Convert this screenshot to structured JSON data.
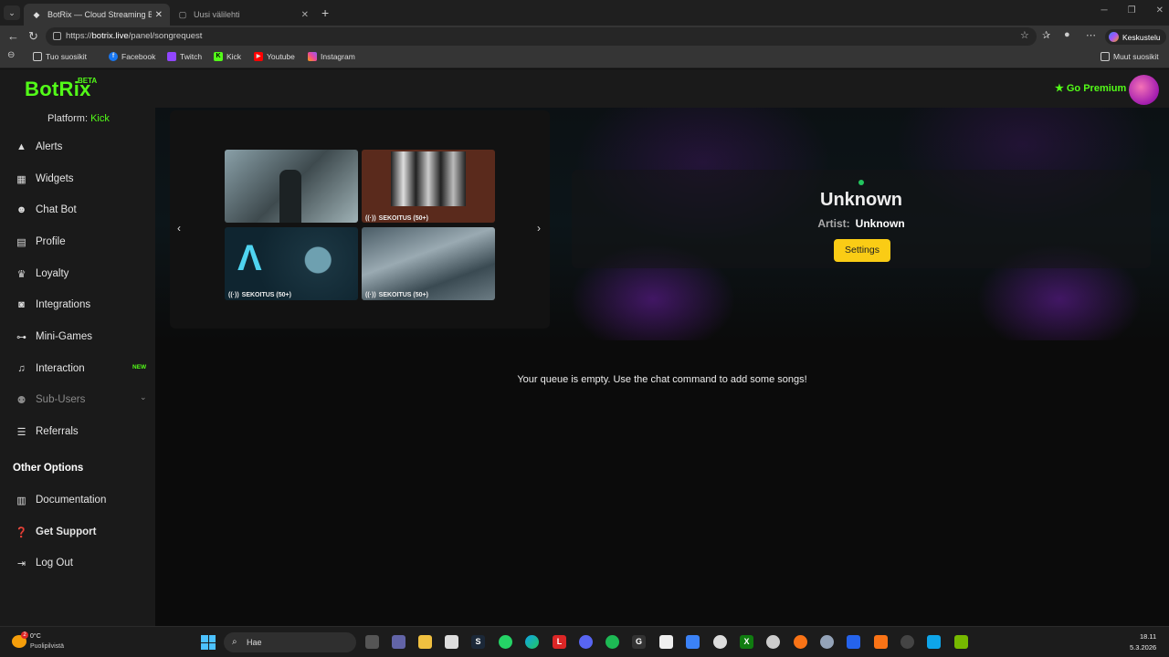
{
  "browser": {
    "tabs": [
      {
        "label": "BotRix — Cloud Streaming Bot for",
        "active": true
      },
      {
        "label": "Uusi välilehti",
        "active": false
      }
    ],
    "url_prefix": "https://",
    "url_host": "botrix.live",
    "url_path": "/panel/songrequest",
    "copilot_label": "Keskustelu",
    "bookmarks": {
      "favorites": "Tuo suosikit",
      "items": [
        "Facebook",
        "Twitch",
        "Kick",
        "Youtube",
        "Instagram"
      ],
      "other": "Muut suosikit"
    }
  },
  "app": {
    "logo": "BotRix",
    "beta": "BETA",
    "go_premium": "Go Premium",
    "platform_label": "Platform:",
    "platform_value": "Kick",
    "nav": [
      {
        "label": "Alerts",
        "icon": "warning-icon"
      },
      {
        "label": "Widgets",
        "icon": "grid-icon"
      },
      {
        "label": "Chat Bot",
        "icon": "robot-icon"
      },
      {
        "label": "Profile",
        "icon": "id-card-icon"
      },
      {
        "label": "Loyalty",
        "icon": "trophy-icon"
      },
      {
        "label": "Integrations",
        "icon": "puzzle-icon"
      },
      {
        "label": "Mini-Games",
        "icon": "gamepad-icon"
      },
      {
        "label": "Interaction",
        "icon": "music-icon",
        "badge": "NEW"
      },
      {
        "label": "Sub-Users",
        "icon": "users-icon",
        "disabled": true
      },
      {
        "label": "Referrals",
        "icon": "list-icon"
      }
    ],
    "other_options_title": "Other Options",
    "other_options": [
      {
        "label": "Documentation",
        "icon": "book-icon"
      },
      {
        "label": "Get Support",
        "icon": "question-icon"
      },
      {
        "label": "Log Out",
        "icon": "logout-icon"
      }
    ]
  },
  "carousel": {
    "captions": [
      "SEKOITUS (50+)",
      "SEKOITUS (50+)",
      "SEKOITUS (50+)"
    ]
  },
  "now_playing": {
    "title": "Unknown",
    "artist_label": "Artist:",
    "artist": "Unknown",
    "settings_label": "Settings"
  },
  "queue": {
    "empty_message": "Your queue is empty. Use the chat command to add some songs!"
  },
  "taskbar": {
    "weather_temp": "0°C",
    "weather_desc": "Puolipilvistä",
    "weather_badge": "2",
    "search_placeholder": "Hae",
    "time": "18.11",
    "date": "5.3.2026"
  }
}
